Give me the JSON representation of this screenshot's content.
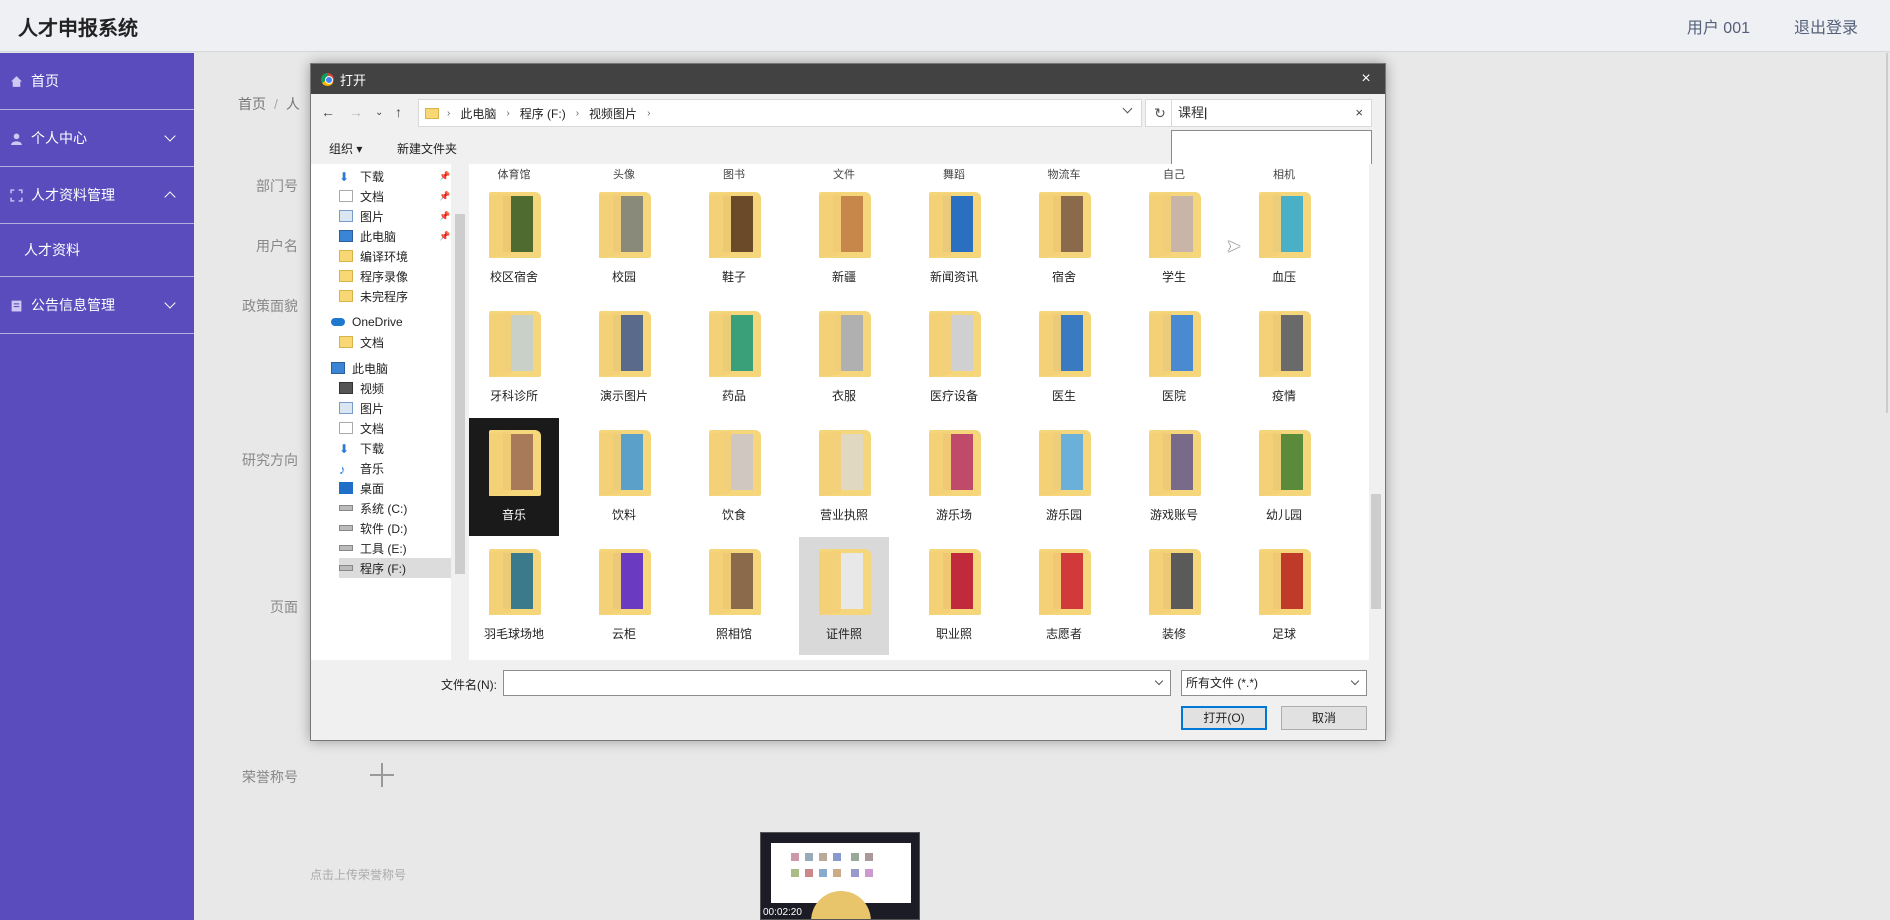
{
  "app": {
    "title": "人才申报系统",
    "user": "用户 001",
    "logout": "退出登录"
  },
  "sidebar": {
    "items": [
      {
        "label": "首页"
      },
      {
        "label": "个人中心"
      },
      {
        "label": "人才资料管理"
      },
      {
        "sub": "人才资料"
      },
      {
        "label": "公告信息管理"
      }
    ]
  },
  "form": {
    "breadcrumb": [
      "首页",
      "人"
    ],
    "labels": {
      "dept": "部门号",
      "user": "用户名",
      "politics": "政策面貌",
      "research": "研究方向",
      "page": "页面",
      "honor": "荣誉称号"
    },
    "upload_hint": "点击上传荣誉称号",
    "video_time": "00:02:20"
  },
  "dialog": {
    "title": "打开",
    "close": "×",
    "address": [
      "此电脑",
      "程序 (F:)",
      "视频图片"
    ],
    "search_value": "课程",
    "organize": "组织 ▾",
    "new_folder": "新建文件夹",
    "tree": [
      {
        "label": "下载",
        "icon": "download-icon",
        "pin": true
      },
      {
        "label": "文档",
        "icon": "document-icon",
        "pin": true
      },
      {
        "label": "图片",
        "icon": "picture-icon",
        "pin": true
      },
      {
        "label": "此电脑",
        "icon": "computer-icon",
        "pin": true
      },
      {
        "label": "编译环境",
        "icon": "folder-icon"
      },
      {
        "label": "程序录像",
        "icon": "folder-icon"
      },
      {
        "label": "未完程序",
        "icon": "folder-icon"
      },
      {
        "label": "OneDrive",
        "icon": "cloud-icon"
      },
      {
        "label": "文档",
        "icon": "folder-icon"
      },
      {
        "label": "此电脑",
        "icon": "computer-icon"
      },
      {
        "label": "视频",
        "icon": "video-icon"
      },
      {
        "label": "图片",
        "icon": "picture-icon"
      },
      {
        "label": "文档",
        "icon": "document-icon"
      },
      {
        "label": "下载",
        "icon": "download-icon"
      },
      {
        "label": "音乐",
        "icon": "music-icon"
      },
      {
        "label": "桌面",
        "icon": "desktop-icon"
      },
      {
        "label": "系统 (C:)",
        "icon": "drive-icon"
      },
      {
        "label": "软件 (D:)",
        "icon": "drive-icon"
      },
      {
        "label": "工具 (E:)",
        "icon": "drive-icon"
      },
      {
        "label": "程序 (F:)",
        "icon": "drive-icon",
        "selected": true
      }
    ],
    "top_labels": [
      "体育馆",
      "头像",
      "图书",
      "文件",
      "舞蹈",
      "物流车",
      "自己",
      "相机"
    ],
    "files": [
      [
        "校区宿舍",
        "校园",
        "鞋子",
        "新疆",
        "新闻资讯",
        "宿舍",
        "学生",
        "血压"
      ],
      [
        "牙科诊所",
        "演示图片",
        "药品",
        "衣服",
        "医疗设备",
        "医生",
        "医院",
        "疫情"
      ],
      [
        "音乐",
        "饮料",
        "饮食",
        "营业执照",
        "游乐场",
        "游乐园",
        "游戏账号",
        "幼儿园"
      ],
      [
        "羽毛球场地",
        "云柜",
        "照相馆",
        "证件照",
        "职业照",
        "志愿者",
        "装修",
        "足球"
      ]
    ],
    "file_name_label": "文件名(N):",
    "file_name_value": "",
    "file_type": "所有文件 (*.*)",
    "open_btn": "打开(O)",
    "cancel_btn": "取消"
  }
}
